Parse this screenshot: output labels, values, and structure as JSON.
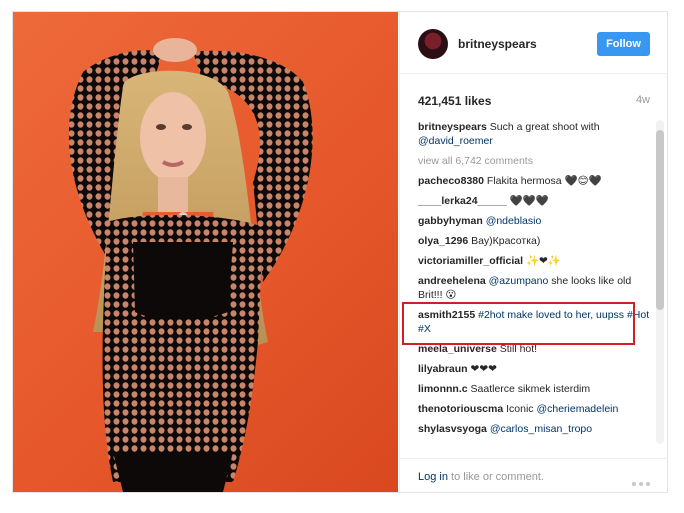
{
  "header": {
    "username": "britneyspears",
    "follow_label": "Follow"
  },
  "post": {
    "likes": "421,451 likes",
    "age": "4w"
  },
  "caption": {
    "user": "britneyspears",
    "text": "Such a great shoot with",
    "mention": "@david_roemer"
  },
  "view_all": "view all 6,742 comments",
  "comments": [
    {
      "user": "pacheco8380",
      "text": "Flakita hermosa 🖤😊🖤",
      "mention": ""
    },
    {
      "user": "____lerka24_____",
      "text": "🖤🖤🖤",
      "mention": ""
    },
    {
      "user": "gabbyhyman",
      "text": "",
      "mention": "@ndeblasio"
    },
    {
      "user": "olya_1296",
      "text": "Вау)Красотка)",
      "mention": ""
    },
    {
      "user": "victoriamiller_official",
      "text": "✨❤✨",
      "mention": ""
    },
    {
      "user": "andreehelena",
      "text": "",
      "mention": "@azumpano",
      "after": " she looks like old Brit!!! 😮"
    },
    {
      "user": "asmith2155",
      "text": "",
      "mention": "#2hot make loved to her, uupss #Hot #X"
    },
    {
      "user": "meela_universe",
      "text": "Still hot!",
      "mention": ""
    },
    {
      "user": "lilyabraun",
      "text": "❤❤❤",
      "mention": ""
    },
    {
      "user": "limonnn.c",
      "text": "Saatlerce sikmek isterdim",
      "mention": ""
    },
    {
      "user": "thenotoriouscma",
      "text": "Iconic",
      "mention": "@cheriemadelein"
    },
    {
      "user": "shylasvsyoga",
      "text": "",
      "mention": "@carlos_misan_tropo"
    }
  ],
  "footer": {
    "login_link": "Log in",
    "login_rest": " to like or comment."
  },
  "icons": {
    "more": "more-options-icon"
  }
}
